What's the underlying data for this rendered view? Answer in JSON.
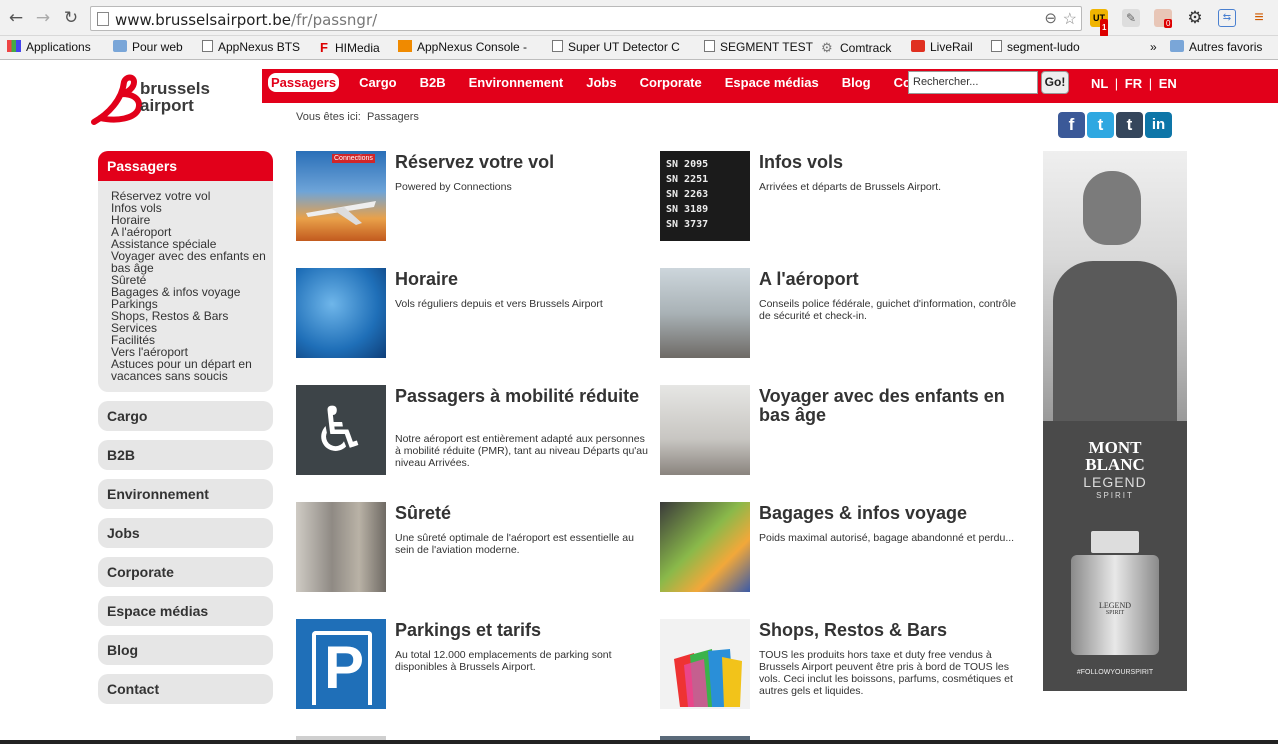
{
  "browser": {
    "url_main": "www.brusselsairport.be",
    "url_path": "/fr/passngr/",
    "ext_badge_ut": "1",
    "ext_badge_2": "0"
  },
  "bookmarks": [
    {
      "label": "Applications"
    },
    {
      "label": "Pour web"
    },
    {
      "label": "AppNexus BTS"
    },
    {
      "label": "HIMedia"
    },
    {
      "label": "AppNexus Console -"
    },
    {
      "label": "Super UT Detector C"
    },
    {
      "label": "SEGMENT TEST"
    },
    {
      "label": "Comtrack"
    },
    {
      "label": "LiveRail"
    },
    {
      "label": "segment-ludo"
    },
    {
      "label": "»"
    },
    {
      "label": "Autres favoris"
    }
  ],
  "site": {
    "logo_line1": "brussels",
    "logo_line2": "airport",
    "nav": [
      "Passagers",
      "Cargo",
      "B2B",
      "Environnement",
      "Jobs",
      "Corporate",
      "Espace médias",
      "Blog",
      "Contact"
    ],
    "search_placeholder": "Rechercher...",
    "go_label": "Go!",
    "lang": {
      "nl": "NL",
      "sep1": "|",
      "fr": "FR",
      "sep2": "|",
      "en": "EN"
    },
    "breadcrumb_label": "Vous êtes ici:",
    "breadcrumb_current": "Passagers"
  },
  "social": [
    {
      "name": "facebook",
      "glyph": "f",
      "color": "#3b5998"
    },
    {
      "name": "twitter",
      "glyph": "t",
      "color": "#2fa8e1"
    },
    {
      "name": "tumblr",
      "glyph": "t",
      "color": "#35465c"
    },
    {
      "name": "linkedin",
      "glyph": "in",
      "color": "#0e76a8"
    }
  ],
  "sidebar": {
    "active_title": "Passagers",
    "items": [
      "Réservez votre vol",
      "Infos vols",
      "Horaire",
      "A l'aéroport",
      "Assistance spéciale",
      "Voyager avec des enfants en",
      "bas âge",
      "Sûreté",
      "Bagages & infos voyage",
      "Parkings",
      "Shops, Restos & Bars",
      "Services",
      "Facilités",
      "Vers l'aéroport",
      "Astuces pour un départ en",
      "vacances sans soucis"
    ],
    "sections": [
      "Cargo",
      "B2B",
      "Environnement",
      "Jobs",
      "Corporate",
      "Espace médias",
      "Blog",
      "Contact"
    ]
  },
  "cards": [
    {
      "title": "Réservez votre vol",
      "desc": "Powered by Connections",
      "thumb_label": "Connections"
    },
    {
      "title": "Infos vols",
      "desc": "Arrivées et départs de Brussels Airport."
    },
    {
      "title": "Horaire",
      "desc": "Vols réguliers depuis et vers Brussels Airport"
    },
    {
      "title": "A l'aéroport",
      "desc": "Conseils police fédérale, guichet d'information, contrôle de sécurité et check-in."
    },
    {
      "title": "Passagers à mobilité réduite",
      "desc": "Notre aéroport est entièrement adapté aux personnes à mobilité réduite (PMR), tant au niveau Départs qu'au niveau Arrivées."
    },
    {
      "title": "Voyager avec des enfants en bas âge",
      "desc": ""
    },
    {
      "title": "Sûreté",
      "desc": "Une sûreté optimale de l'aéroport est essentielle au sein de l'aviation moderne."
    },
    {
      "title": "Bagages & infos voyage",
      "desc": "Poids maximal autorisé, bagage abandonné et perdu..."
    },
    {
      "title": "Parkings et tarifs",
      "desc": "Au total 12.000 emplacements de parking sont disponibles à Brussels Airport."
    },
    {
      "title": "Shops, Restos & Bars",
      "desc": "TOUS les produits hors taxe et duty free vendus à Brussels Airport peuvent être pris à bord de TOUS les vols. Ceci inclut les boissons, parfums, cosmétiques et autres gels et liquides."
    }
  ],
  "flight_board": [
    "SN 2095",
    "SN 2251",
    "SN 2263",
    "SN 3189",
    "SN 3737"
  ],
  "ad": {
    "brand_line1": "MONT",
    "brand_line2": "BLANC",
    "product_line1": "LEGEND",
    "product_line2": "SPIRIT",
    "bottle_label1": "LEGEND",
    "bottle_label2": "SPIRIT",
    "hashtag": "#FOLLOWYOURSPIRIT"
  },
  "colors": {
    "brand_red": "#e2001a",
    "sidebar_gray": "#e6e6e6",
    "text_dark": "#333333"
  }
}
